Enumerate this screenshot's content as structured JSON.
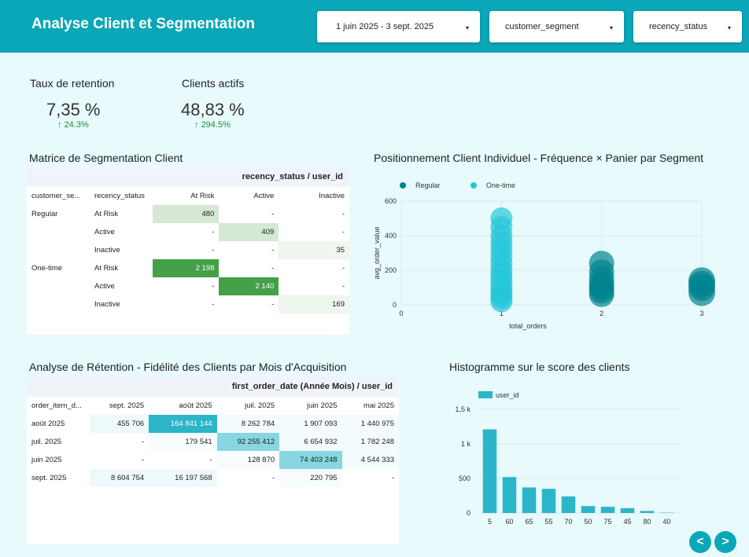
{
  "header": {
    "title": "Analyse Client et Segmentation",
    "filters": {
      "date_range": "1 juin 2025 - 3 sept. 2025",
      "segment": "customer_segment",
      "recency": "recency_status"
    }
  },
  "kpis": {
    "retention": {
      "label": "Taux de retention",
      "value": "7,35 %",
      "delta": "24.3%"
    },
    "active": {
      "label": "Clients actifs",
      "value": "48,83 %",
      "delta": "294.5%"
    }
  },
  "segmentation": {
    "title": "Matrice de Segmentation Client",
    "pivot_header": "recency_status / user_id",
    "columns": [
      "customer_se...",
      "recency_status",
      "At Risk",
      "Active",
      "Inactive"
    ],
    "rows": [
      {
        "segment": "Regular",
        "status": "At Risk",
        "at_risk": "480",
        "active": "-",
        "inactive": "-"
      },
      {
        "segment": "",
        "status": "Active",
        "at_risk": "-",
        "active": "409",
        "inactive": "-"
      },
      {
        "segment": "",
        "status": "Inactive",
        "at_risk": "-",
        "active": "-",
        "inactive": "35"
      },
      {
        "segment": "One-time",
        "status": "At Risk",
        "at_risk": "2 198",
        "active": "-",
        "inactive": "-"
      },
      {
        "segment": "",
        "status": "Active",
        "at_risk": "-",
        "active": "2 140",
        "inactive": "-"
      },
      {
        "segment": "",
        "status": "Inactive",
        "at_risk": "-",
        "active": "-",
        "inactive": "169"
      }
    ],
    "colors": {
      "light": "#d4e8d4",
      "strong": "#43a047",
      "faint": "#eef6ee"
    }
  },
  "retention": {
    "title": "Analyse de Rétention - Fidélité des Clients par Mois d'Acquisition",
    "pivot_header": "first_order_date (Année Mois) / user_id",
    "columns": [
      "order_item_d...",
      "sept. 2025",
      "août 2025",
      "juil. 2025",
      "juin 2025",
      "mai 2025"
    ],
    "rows": [
      {
        "label": "août 2025",
        "c1": "455 706",
        "c2": "164 841 144",
        "c3": "8 262 784",
        "c4": "1 907 093",
        "c5": "1 440 975"
      },
      {
        "label": "juil. 2025",
        "c1": "-",
        "c2": "179 541",
        "c3": "92 255 412",
        "c4": "6 654 932",
        "c5": "1 782 248"
      },
      {
        "label": "juin 2025",
        "c1": "-",
        "c2": "-",
        "c3": "128 870",
        "c4": "74 403 248",
        "c5": "4 544 333"
      },
      {
        "label": "sept. 2025",
        "c1": "8 604 754",
        "c2": "16 197 568",
        "c3": "-",
        "c4": "220 795",
        "c5": "-"
      }
    ]
  },
  "charts": {
    "bubble": {
      "title": "Positionnement Client Individuel - Fréquence × Panier par Segment",
      "xlabel": "total_orders",
      "ylabel": "avg_order_value",
      "legend": [
        "Regular",
        "One-time"
      ],
      "colors": {
        "Regular": "#00838f",
        "One-time": "#26c6da"
      },
      "xticks": [
        "0",
        "1",
        "2",
        "3"
      ],
      "yticks": [
        "0",
        "200",
        "400",
        "600"
      ]
    },
    "histogram": {
      "title": "Histogramme sur le score des clients",
      "legend": "user_id",
      "color": "#2bb5c8",
      "yticks": [
        "0",
        "500",
        "1 k",
        "1,5 k"
      ]
    }
  },
  "chart_data": [
    {
      "type": "scatter",
      "title": "Positionnement Client Individuel - Fréquence × Panier par Segment",
      "xlabel": "total_orders",
      "ylabel": "avg_order_value",
      "xlim": [
        0,
        3
      ],
      "ylim": [
        0,
        600
      ],
      "series": [
        {
          "name": "One-time",
          "points": [
            [
              1,
              500
            ],
            [
              1,
              450
            ],
            [
              1,
              400
            ],
            [
              1,
              360
            ],
            [
              1,
              320
            ],
            [
              1,
              280
            ],
            [
              1,
              240
            ],
            [
              1,
              200
            ],
            [
              1,
              170
            ],
            [
              1,
              140
            ],
            [
              1,
              110
            ],
            [
              1,
              80
            ],
            [
              1,
              60
            ],
            [
              1,
              40
            ],
            [
              1,
              20
            ]
          ]
        },
        {
          "name": "Regular",
          "points": [
            [
              2,
              240
            ],
            [
              2,
              190
            ],
            [
              2,
              150
            ],
            [
              2,
              120
            ],
            [
              2,
              100
            ],
            [
              2,
              80
            ],
            [
              2,
              60
            ],
            [
              3,
              140
            ],
            [
              3,
              120
            ],
            [
              3,
              100
            ],
            [
              3,
              70
            ]
          ]
        }
      ]
    },
    {
      "type": "bar",
      "title": "Histogramme sur le score des clients",
      "categories": [
        "5",
        "60",
        "65",
        "55",
        "70",
        "50",
        "75",
        "45",
        "80",
        "40"
      ],
      "series": [
        {
          "name": "user_id",
          "values": [
            1210,
            520,
            370,
            350,
            240,
            100,
            90,
            70,
            30,
            5
          ]
        }
      ],
      "ylim": [
        0,
        1500
      ]
    }
  ]
}
